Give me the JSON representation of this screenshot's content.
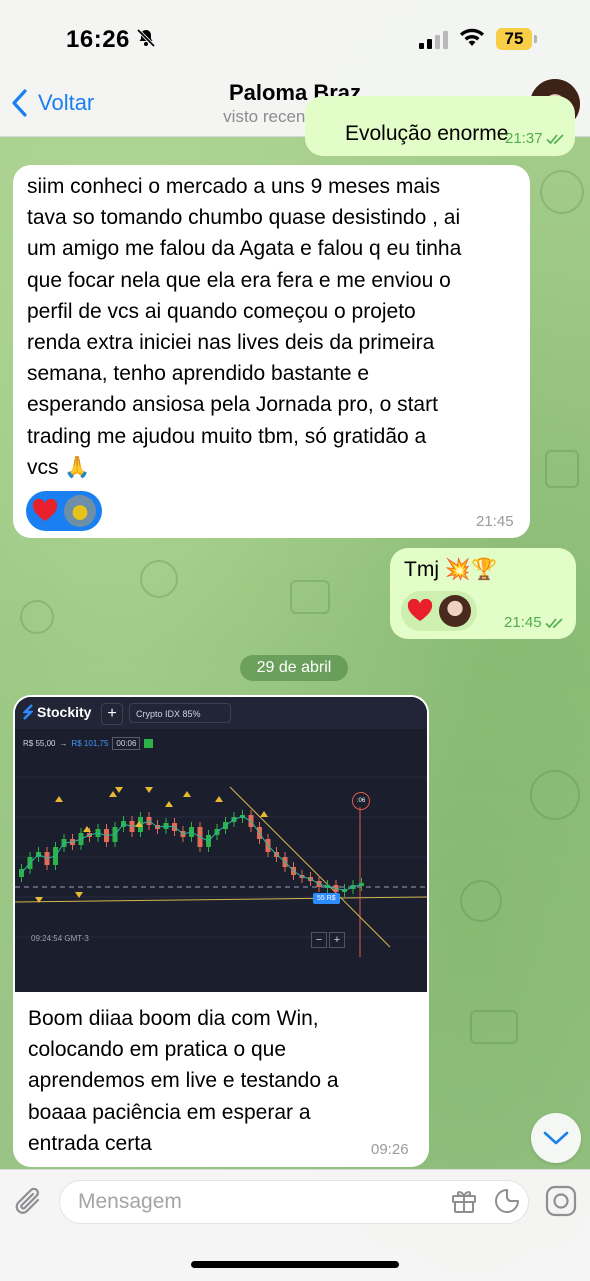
{
  "status_bar": {
    "time": "16:26",
    "battery": "75"
  },
  "header": {
    "back_label": "Voltar",
    "contact_name": "Paloma Braz",
    "contact_status": "visto recentemente"
  },
  "messages": [
    {
      "direction": "out",
      "text": "Evolução enorme",
      "time": "21:37",
      "read": true
    },
    {
      "direction": "in",
      "text": "siim conheci o mercado a uns 9 meses mais\ntava so tomando chumbo quase desistindo , ai\num amigo me falou da Agata e falou q eu tinha\nque focar nela que ela era fera e me enviou o\nperfil de vcs ai quando começou o projeto\nrenda extra iniciei nas lives deis da primeira\nsemana, tenho aprendido bastante e\nesperando ansiosa pela Jornada pro, o start\ntrading me ajudou muito tbm, só gratidão a\nvcs 🙏",
      "time": "21:45"
    },
    {
      "direction": "out",
      "text": "Tmj 💥🏆",
      "time": "21:45",
      "read": true
    },
    {
      "direction": "in",
      "text": "Boom diiaa boom dia com Win,\ncolocando em pratica o que\naprendemos em live e testando a\nboaaa paciência em esperar a\nentrada certa",
      "time": "09:26"
    }
  ],
  "date_divider": "29 de abril",
  "chart_screenshot": {
    "app_name": "Stockity",
    "plus": "+",
    "asset": "Crypto IDX  85%",
    "price_range_start": "R$ 55,00",
    "price_range_end": "R$ 101,75",
    "timer_box": "00:06",
    "timer_marker": ":06",
    "trade_price": "55 R$",
    "clock": "09:24:54 GMT-3",
    "zoom_out": "−",
    "zoom_in": "+"
  },
  "input": {
    "placeholder": "Mensagem"
  },
  "colors": {
    "accent": "#1a7ff0",
    "outgoing_bubble": "#e3fdc8",
    "incoming_bubble": "#ffffff",
    "battery": "#f7ce46"
  },
  "icons": [
    "bell-slash-icon",
    "signal-icon",
    "wifi-icon",
    "chevron-left-icon",
    "heart-icon",
    "double-check-icon",
    "paperclip-icon",
    "gift-icon",
    "sticker-icon",
    "camera-icon",
    "chevron-down-icon"
  ]
}
